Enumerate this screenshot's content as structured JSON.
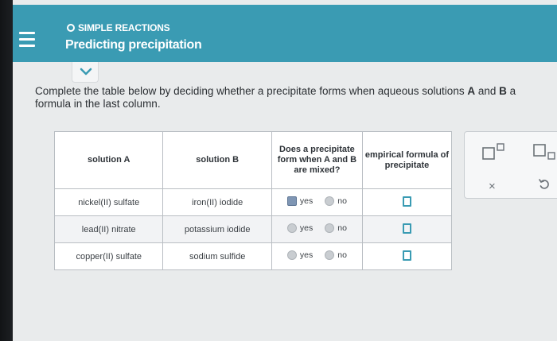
{
  "header": {
    "topic": "SIMPLE REACTIONS",
    "title": "Predicting precipitation"
  },
  "instructions": {
    "part1": "Complete the table below by deciding whether a precipitate forms when aqueous solutions ",
    "a": "A",
    "and": " and ",
    "b": "B",
    "part2": " a",
    "line2": "formula in the last column."
  },
  "table": {
    "headers": {
      "solution_a": "solution A",
      "solution_b": "solution B",
      "precipitate": "Does a precipitate form when A and B are mixed?",
      "formula": "empirical formula of precipitate"
    },
    "yes_label": "yes",
    "no_label": "no",
    "rows": [
      {
        "solution_a": "nickel(II) sulfate",
        "solution_b": "iron(II) iodide",
        "selected": "yes"
      },
      {
        "solution_a": "lead(II) nitrate",
        "solution_b": "potassium iodide",
        "selected": ""
      },
      {
        "solution_a": "copper(II) sulfate",
        "solution_b": "sodium sulfide",
        "selected": ""
      }
    ]
  },
  "tools": {
    "superscript": "superscript-icon",
    "subscript": "subscript-icon",
    "clear": "×",
    "undo": "undo-icon"
  },
  "colors": {
    "header_bg": "#3a9bb3",
    "accent": "#3a9bb3",
    "selected_radio": "#7f96b4"
  }
}
